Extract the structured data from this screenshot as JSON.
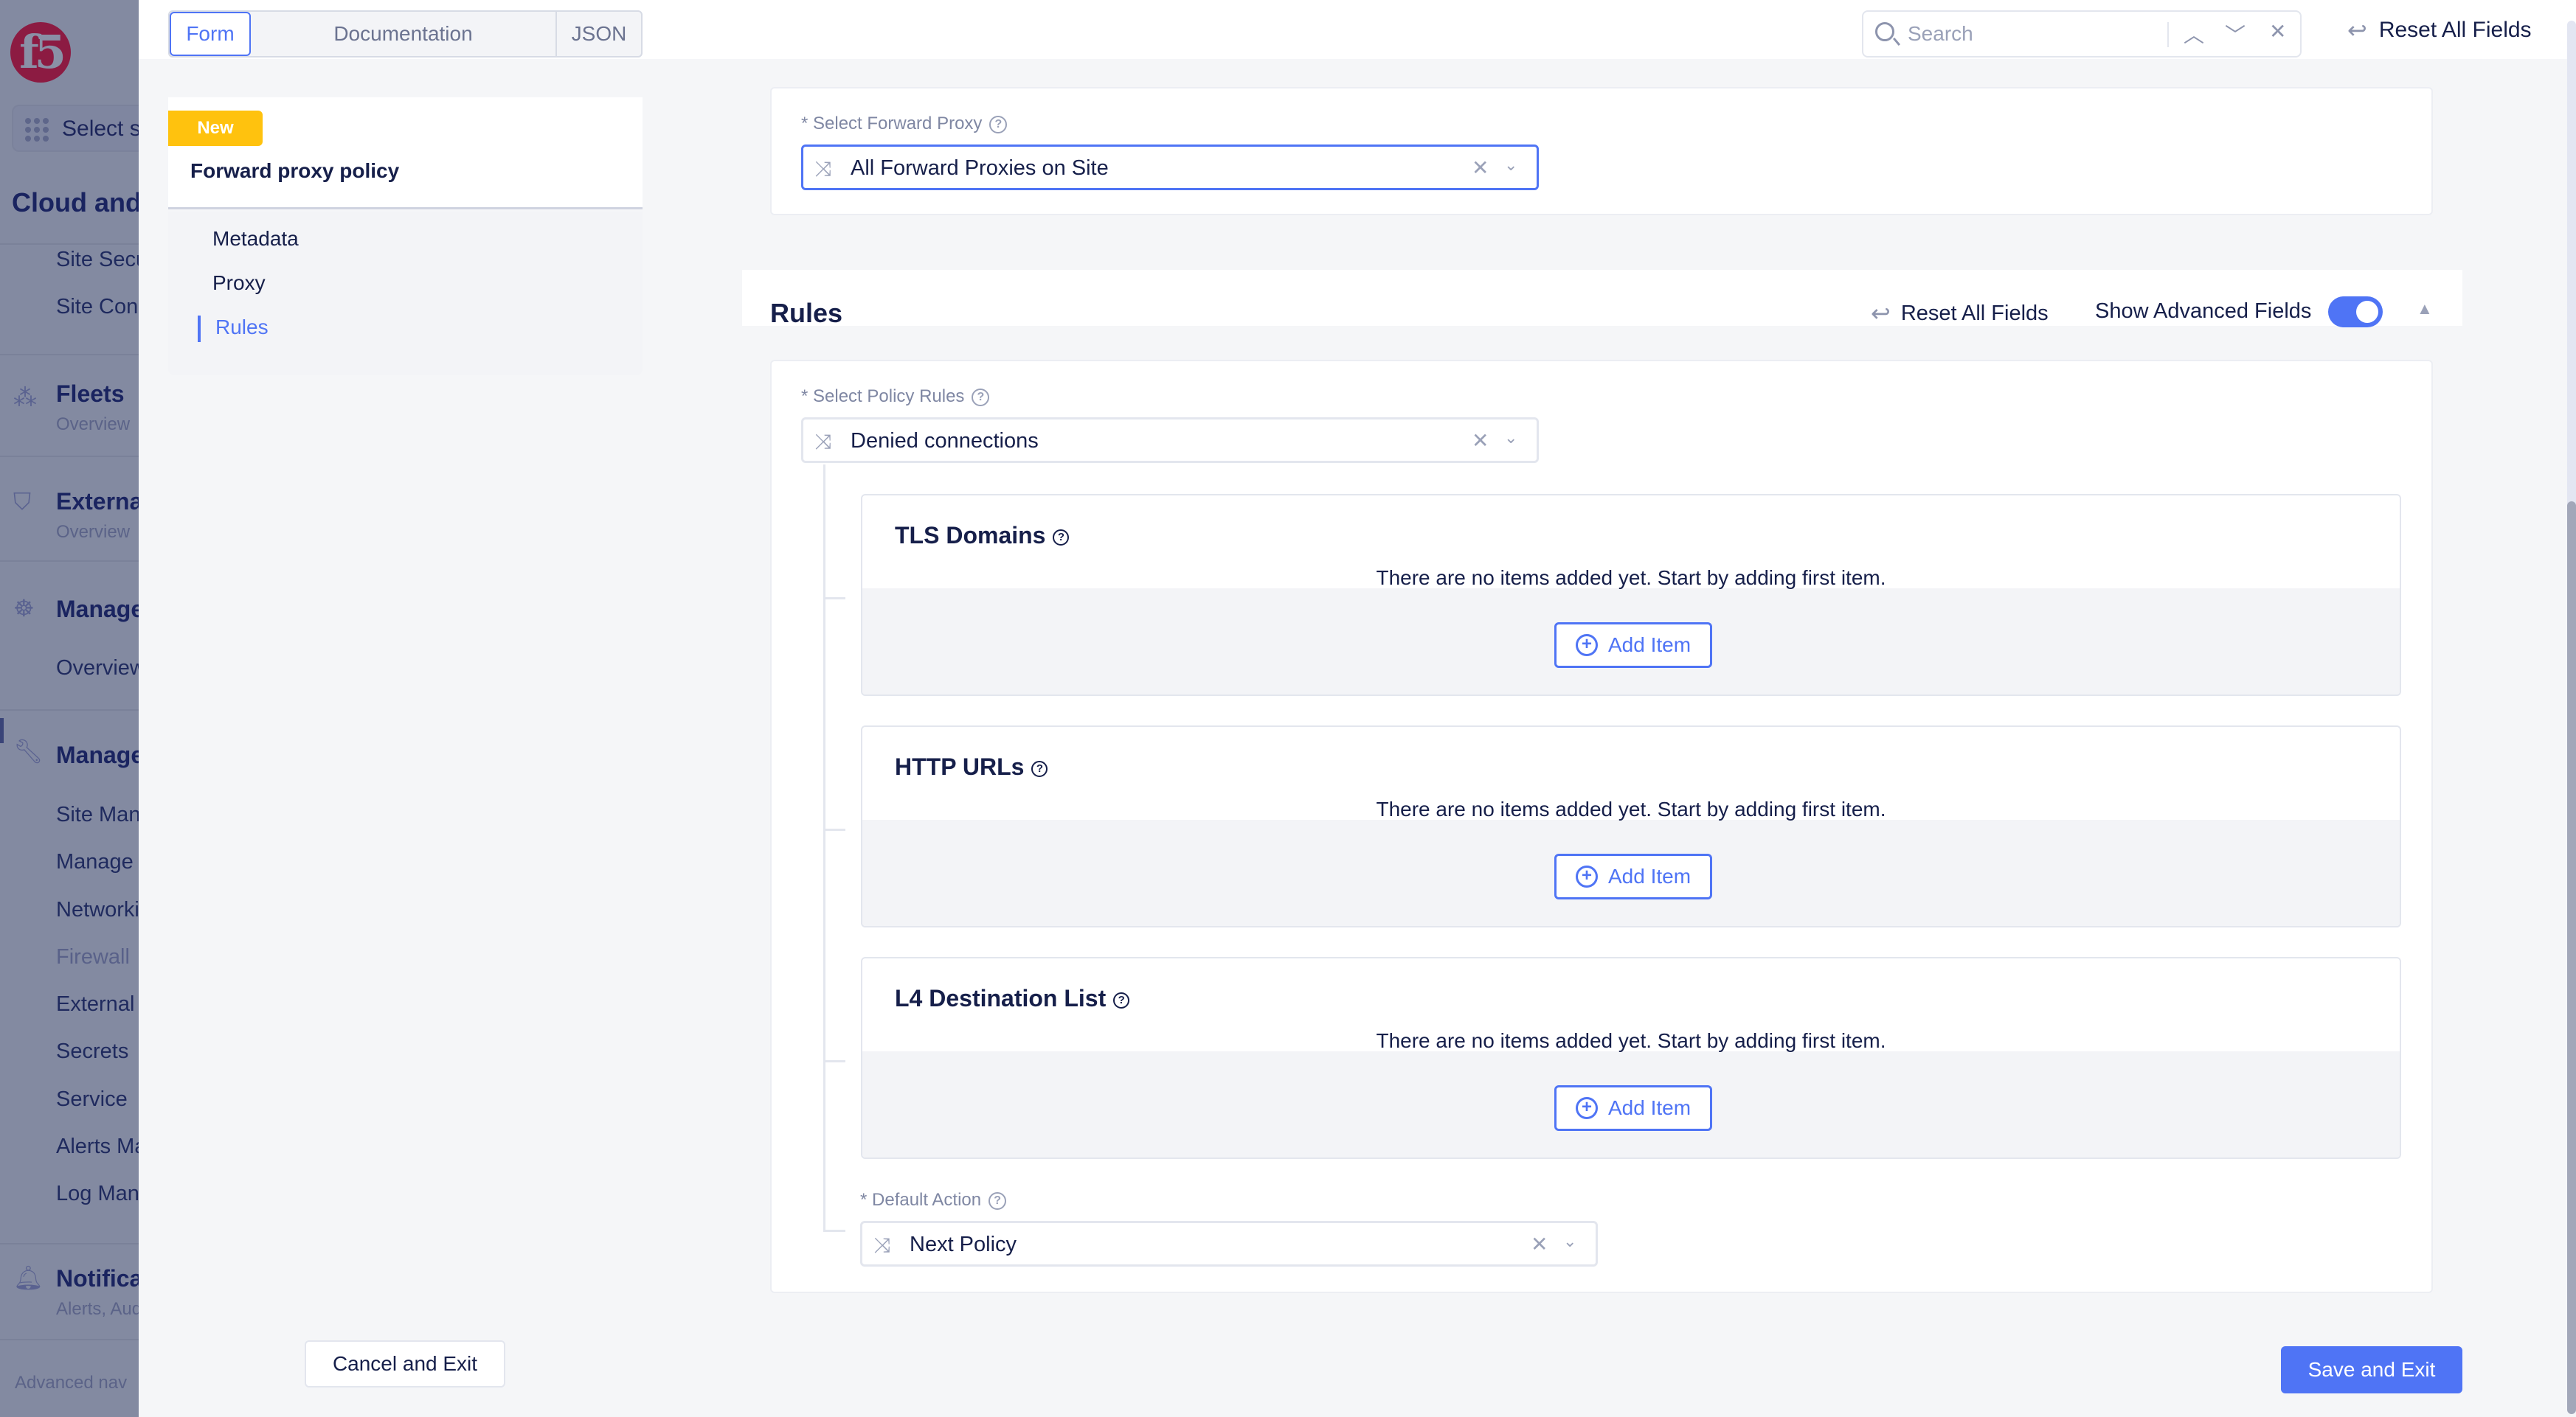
{
  "leftnav": {
    "logo": "f5",
    "workspace_selector": "Select service",
    "section_title": "Cloud and Edge Sites",
    "section_items": [
      "Site Security",
      "Site Connectivity"
    ],
    "groups": [
      {
        "title": "Fleets",
        "caption": "Overview",
        "icon": "fleets-icon"
      },
      {
        "title": "External Services",
        "caption": "Overview",
        "icon": "external-shield-icon"
      },
      {
        "title": "Manage",
        "caption": "",
        "icon": "helm-icon",
        "items": [
          "Overview"
        ]
      },
      {
        "title": "Manage",
        "caption": "",
        "icon": "wrench-icon",
        "active": true,
        "items": [
          "Site Management",
          "Manage",
          "Networking",
          "Firewall",
          "External",
          "Secrets",
          "Service",
          "Alerts Management",
          "Log Management"
        ]
      },
      {
        "title": "Notifications",
        "caption": "Alerts, Audit",
        "icon": "bell-icon"
      }
    ],
    "footer": "Advanced nav"
  },
  "topbar": {
    "tabs": [
      {
        "label": "Form",
        "active": true
      },
      {
        "label": "Documentation",
        "active": false
      },
      {
        "label": "JSON",
        "active": false
      }
    ],
    "search": {
      "placeholder": "Search",
      "value": ""
    },
    "reset_all": "Reset All Fields"
  },
  "sections": {
    "badge": "New",
    "title": "Forward proxy policy",
    "items": [
      {
        "label": "Metadata",
        "active": false
      },
      {
        "label": "Proxy",
        "active": false
      },
      {
        "label": "Rules",
        "active": true
      }
    ]
  },
  "proxy": {
    "label": "* Select Forward Proxy",
    "value": "All Forward Proxies on Site"
  },
  "rules": {
    "title": "Rules",
    "reset_all": "Reset All Fields",
    "show_advanced_label": "Show Advanced Fields",
    "show_advanced": true,
    "policy_rules_label": "* Select Policy Rules",
    "policy_rules_value": "Denied connections",
    "lists": [
      {
        "title": "TLS Domains",
        "empty_text": "There are no items added yet. Start by adding first item.",
        "add_label": "Add Item"
      },
      {
        "title": "HTTP URLs",
        "empty_text": "There are no items added yet. Start by adding first item.",
        "add_label": "Add Item"
      },
      {
        "title": "L4 Destination List",
        "empty_text": "There are no items added yet. Start by adding first item.",
        "add_label": "Add Item"
      }
    ],
    "default_action_label": "* Default Action",
    "default_action_value": "Next Policy"
  },
  "footer": {
    "cancel": "Cancel and Exit",
    "save": "Save and Exit"
  },
  "colors": {
    "accent": "#4f74f5",
    "badge": "#ffc20e",
    "text": "#161f4a",
    "nav_overlay": "#838aa1"
  }
}
